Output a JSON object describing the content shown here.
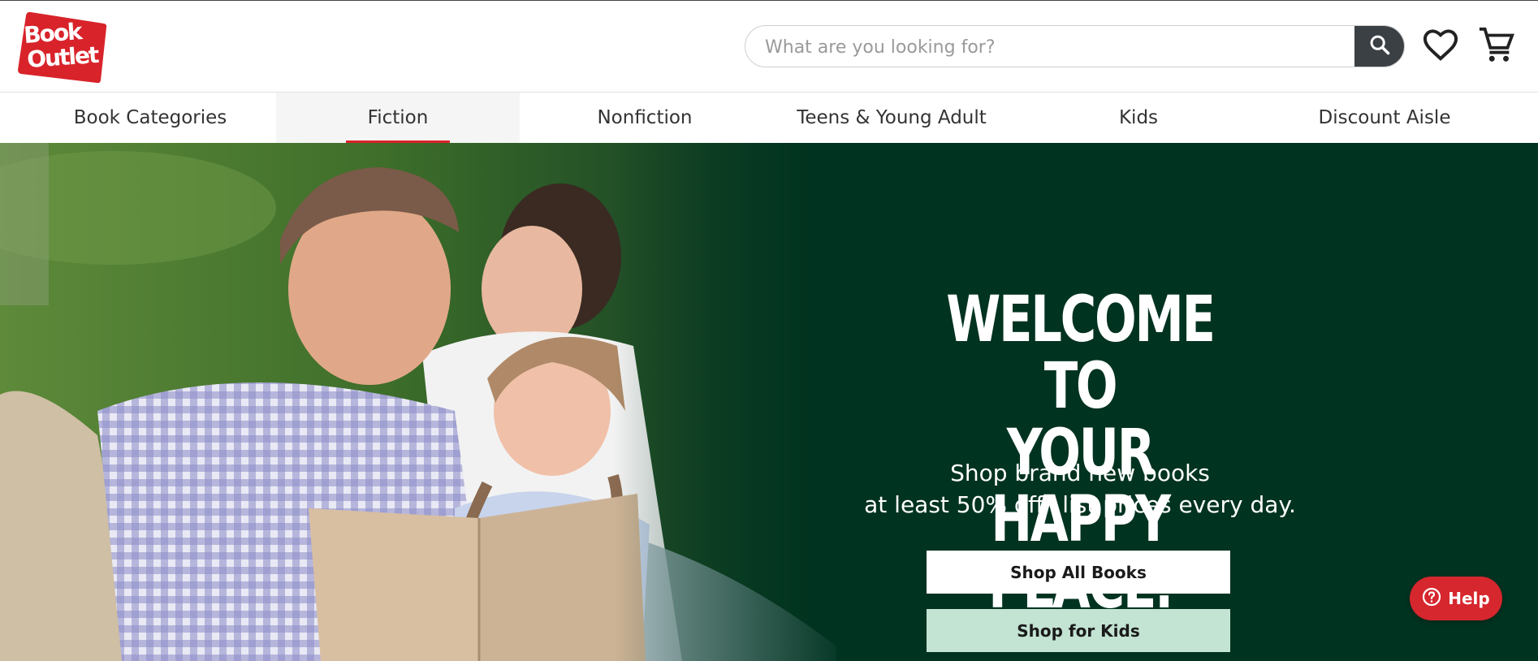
{
  "brand": {
    "logo_line1": "Book",
    "logo_line2": "Outlet"
  },
  "search": {
    "placeholder": "What are you looking for?",
    "value": ""
  },
  "icons": [
    "search-icon",
    "heart-icon",
    "cart-icon",
    "help-icon"
  ],
  "nav": {
    "items": [
      {
        "label": "Book Categories"
      },
      {
        "label": "Fiction"
      },
      {
        "label": "Nonfiction"
      },
      {
        "label": "Teens & Young Adult"
      },
      {
        "label": "Kids"
      },
      {
        "label": "Discount Aisle"
      }
    ],
    "active": "Fiction"
  },
  "hero": {
    "title": "WELCOME TO\nYOUR HAPPY\nPLACE.",
    "subtitle_line1": "Shop brand new books",
    "subtitle_line2": "at least 50% off* list prices every day.",
    "btn_all": "Shop All Books",
    "btn_kids": "Shop for Kids"
  },
  "help": {
    "label": "Help"
  },
  "colors": {
    "brand_red": "#d8232a",
    "hero_green": "#003320",
    "kids_button": "#c3e3d3",
    "dark_button": "#3b4045"
  }
}
